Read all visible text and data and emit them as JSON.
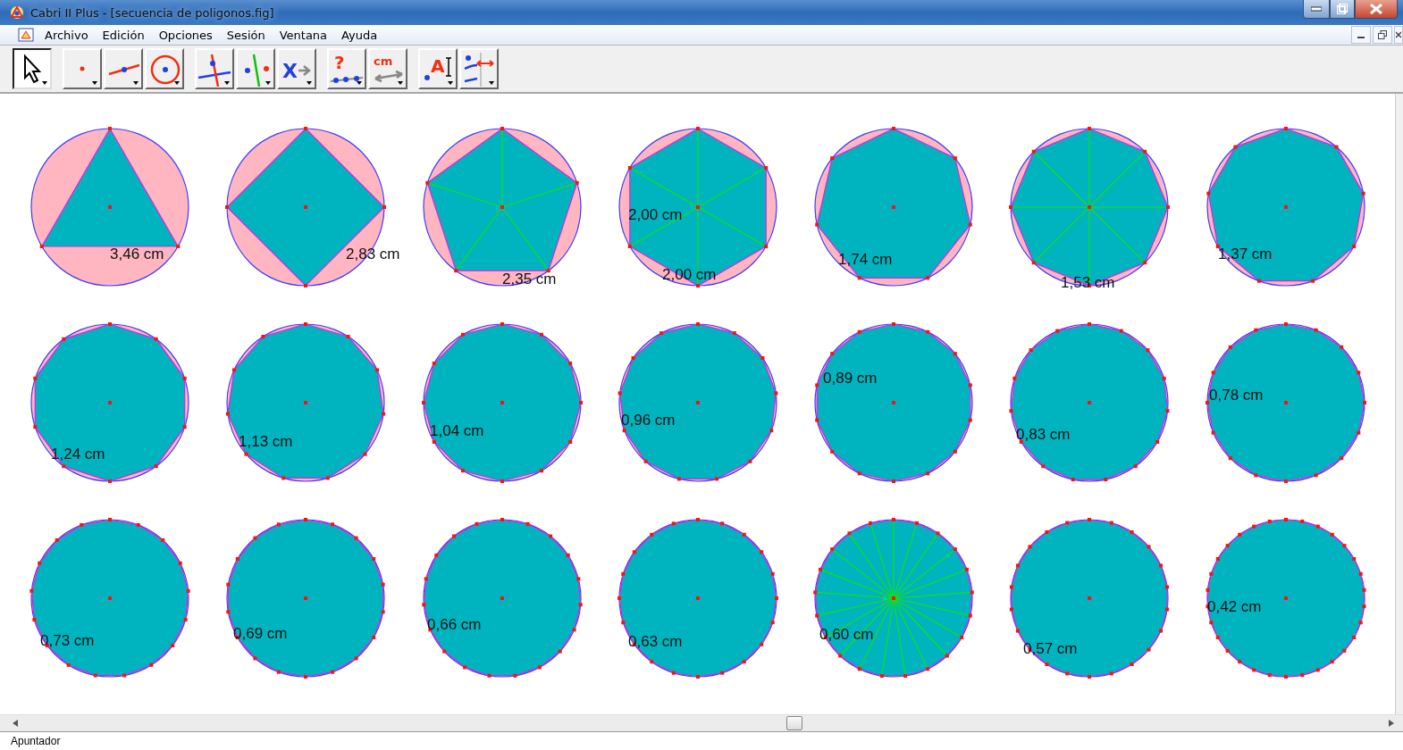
{
  "window": {
    "title": "Cabri II Plus - [secuencia de poligonos.fig]"
  },
  "menu": [
    "Archivo",
    "Edición",
    "Opciones",
    "Sesión",
    "Ventana",
    "Ayuda"
  ],
  "toolbar": [
    {
      "tools": [
        {
          "kind": "pointer",
          "selected": true
        }
      ]
    },
    {
      "tools": [
        {
          "kind": "point",
          "selected": false
        },
        {
          "kind": "line",
          "selected": false
        },
        {
          "kind": "circle",
          "selected": false
        }
      ]
    },
    {
      "tools": [
        {
          "kind": "perpendicular",
          "selected": false
        },
        {
          "kind": "symmetry",
          "selected": false
        },
        {
          "kind": "macro",
          "glyph": "X",
          "selected": false
        }
      ]
    },
    {
      "tools": [
        {
          "kind": "check",
          "glyph": "?",
          "selected": false
        },
        {
          "kind": "measure",
          "glyph": "cm",
          "selected": false
        }
      ]
    },
    {
      "tools": [
        {
          "kind": "text",
          "glyph": "A",
          "selected": false
        },
        {
          "kind": "display",
          "selected": false
        }
      ]
    }
  ],
  "figures": [
    {
      "labels": [
        "3,46 cm"
      ]
    },
    {
      "labels": [
        "2,83 cm"
      ]
    },
    {
      "spokes": true,
      "labels": [
        "2,35 cm"
      ]
    },
    {
      "spokes": true,
      "labels": [
        "2,00 cm",
        "2,00 cm"
      ]
    },
    {
      "labels": [
        "1,74 cm"
      ]
    },
    {
      "spokes": true,
      "labels": [
        "1,53 cm"
      ]
    },
    {
      "labels": [
        "1,37 cm"
      ]
    },
    {
      "labels": [
        "1,24 cm"
      ]
    },
    {
      "labels": [
        "1,13 cm"
      ]
    },
    {
      "labels": [
        "1,04 cm"
      ]
    },
    {
      "labels": [
        "0,96 cm"
      ]
    },
    {
      "labels": [
        "0,89 cm"
      ]
    },
    {
      "labels": [
        "0,83 cm"
      ]
    },
    {
      "labels": [
        "0,78 cm"
      ]
    },
    {
      "labels": [
        "0,73 cm"
      ]
    },
    {
      "labels": [
        "0,69 cm"
      ]
    },
    {
      "labels": [
        "0,66 cm"
      ]
    },
    {
      "labels": [
        "0,63 cm"
      ]
    },
    {
      "spokes": true,
      "labels": [
        "0,60 cm"
      ]
    },
    {
      "labels": [
        "0,57 cm"
      ]
    },
    {
      "labels": [
        "0,42 cm"
      ]
    }
  ],
  "status_bar": "Apuntador"
}
